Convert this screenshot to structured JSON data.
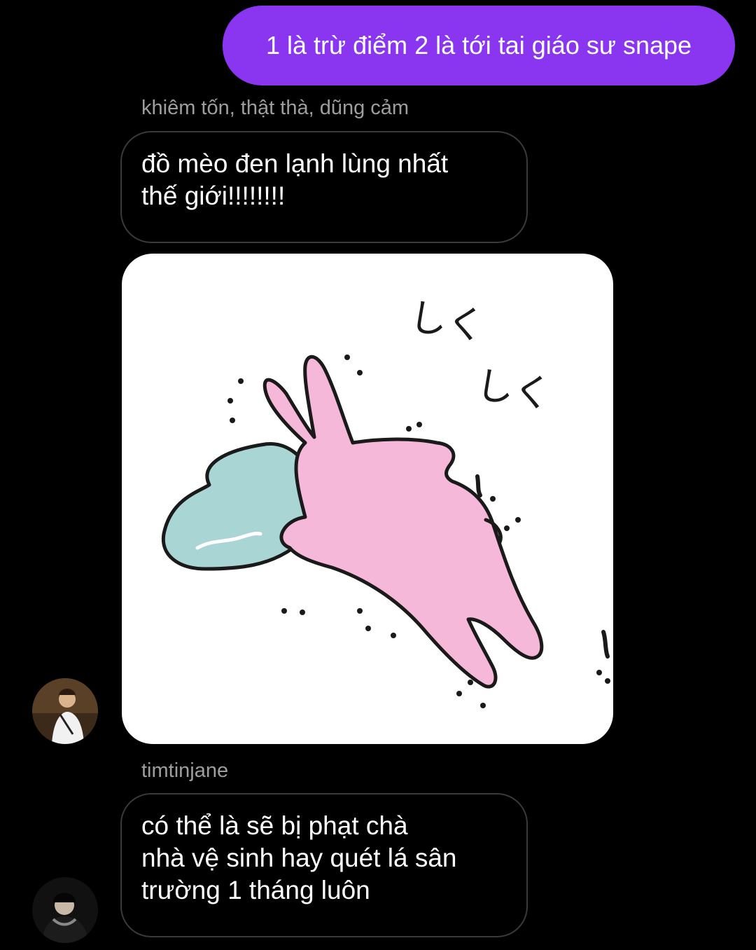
{
  "outgoing_message": {
    "text": "1 là trừ điểm 2 là tới tai giáo sư snape"
  },
  "group_1": {
    "sender": "khiêm tốn, thật thà, dũng cảm",
    "message_lines": [
      "đồ mèo đen lạnh lùng nhất",
      "thế giới!!!!!!!!"
    ],
    "sticker": {
      "sfx_top": "しく",
      "sfx_right": "しく"
    }
  },
  "group_2": {
    "sender": "timtinjane",
    "message_lines": [
      "có thể là sẽ bị phạt chà",
      "nhà vệ sinh hay quét lá sân",
      "trường 1 tháng luôn"
    ]
  },
  "colors": {
    "background": "#000000",
    "outgoing_bubble": "#8a35f0",
    "incoming_border": "#3a3a3a",
    "sender_text": "#9e9e9e",
    "rabbit_pink": "#f6b8d8",
    "blanket_blue": "#a9d6d4"
  }
}
